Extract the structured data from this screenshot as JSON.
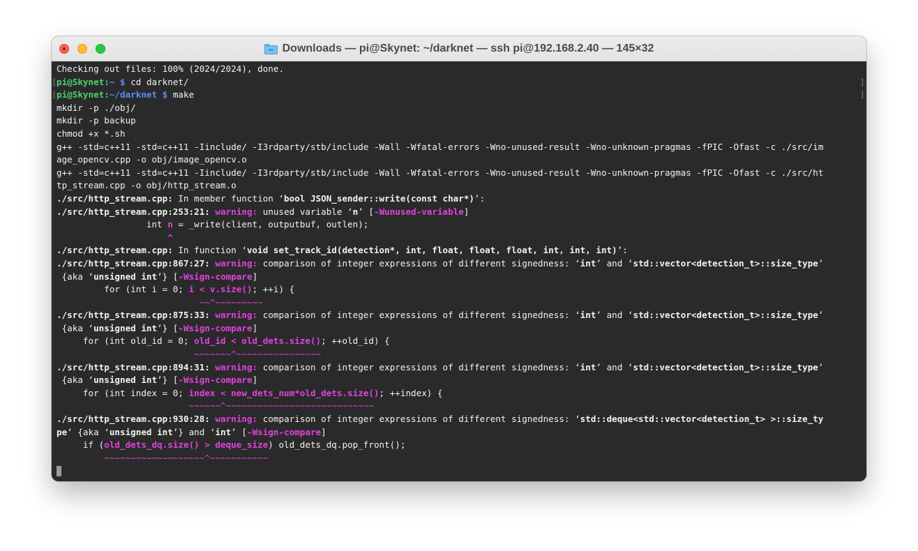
{
  "window": {
    "title": "Downloads — pi@Skynet: ~/darknet — ssh pi@192.168.2.40 — 145×32",
    "folder_icon": "folder-icon",
    "accent_magenta": "#e042e0",
    "prompt_user_color": "#4cd26b",
    "prompt_path_color": "#5b8cff"
  },
  "terminal": {
    "l1": "Checking out files: 100% (2024/2024), done.",
    "p1": {
      "bl": "[",
      "user": "pi@Skynet",
      "colon": ":",
      "path": "~",
      "dollar": " $",
      "cmd": " cd darknet/",
      "br": "]"
    },
    "p2": {
      "bl": "[",
      "user": "pi@Skynet",
      "colon": ":",
      "path": "~/darknet",
      "dollar": " $",
      "cmd": " make",
      "br": "]"
    },
    "l4": "mkdir -p ./obj/",
    "l5": "mkdir -p backup",
    "l6": "chmod +x *.sh",
    "l7": "g++ -std=c++11 -std=c++11 -Iinclude/ -I3rdparty/stb/include -Wall -Wfatal-errors -Wno-unused-result -Wno-unknown-pragmas -fPIC -Ofast -c ./src/im",
    "l8": "age_opencv.cpp -o obj/image_opencv.o",
    "l9": "g++ -std=c++11 -std=c++11 -Iinclude/ -I3rdparty/stb/include -Wall -Wfatal-errors -Wno-unused-result -Wno-unknown-pragmas -fPIC -Ofast -c ./src/ht",
    "l10": "tp_stream.cpp -o obj/http_stream.o",
    "l11": {
      "a": "./src/http_stream.cpp:",
      "b": " In member function ‘",
      "c": "bool JSON_sender::write(const char*)",
      "d": "’:"
    },
    "l12": {
      "a": "./src/http_stream.cpp:253:21:",
      "b": " ",
      "w": "warning:",
      "c": " unused variable ‘",
      "d": "n",
      "e": "’ [",
      "f": "-Wunused-variable",
      "g": "]"
    },
    "l13": {
      "a": "                 int ",
      "b": "n",
      "c": " = _write(client, outputbuf, outlen);"
    },
    "l14": "                     ^",
    "l15": {
      "a": "./src/http_stream.cpp:",
      "b": " In function ‘",
      "c": "void set_track_id(detection*, int, float, float, float, int, int, int)",
      "d": "’:"
    },
    "l16": {
      "a": "./src/http_stream.cpp:867:27:",
      "b": " ",
      "w": "warning:",
      "c": " comparison of integer expressions of different signedness: ‘",
      "d": "int",
      "e": "’ and ‘",
      "f": "std::vector<detection_t>::size_type",
      "g": "’"
    },
    "l17": {
      "a": " {aka ‘",
      "b": "unsigned int",
      "c": "’} [",
      "d": "-Wsign-compare",
      "e": "]"
    },
    "l18": {
      "a": "         for (int i = 0; ",
      "b": "i < v.size()",
      "c": "; ++i) {"
    },
    "l19": "                           ~~^~~~~~~~~~",
    "l20": {
      "a": "./src/http_stream.cpp:875:33:",
      "b": " ",
      "w": "warning:",
      "c": " comparison of integer expressions of different signedness: ‘",
      "d": "int",
      "e": "’ and ‘",
      "f": "std::vector<detection_t>::size_type",
      "g": "’"
    },
    "l21": {
      "a": " {aka ‘",
      "b": "unsigned int",
      "c": "’} [",
      "d": "-Wsign-compare",
      "e": "]"
    },
    "l22": {
      "a": "     for (int old_id = 0; ",
      "b": "old_id < old_dets.size()",
      "c": "; ++old_id) {"
    },
    "l23": "                          ~~~~~~~^~~~~~~~~~~~~~~~~",
    "l24": {
      "a": "./src/http_stream.cpp:894:31:",
      "b": " ",
      "w": "warning:",
      "c": " comparison of integer expressions of different signedness: ‘",
      "d": "int",
      "e": "’ and ‘",
      "f": "std::vector<detection_t>::size_type",
      "g": "’"
    },
    "l25": {
      "a": " {aka ‘",
      "b": "unsigned int",
      "c": "’} [",
      "d": "-Wsign-compare",
      "e": "]"
    },
    "l26": {
      "a": "     for (int index = 0; ",
      "b": "index < new_dets_num*old_dets.size()",
      "c": "; ++index) {"
    },
    "l27": "                         ~~~~~~^~~~~~~~~~~~~~~~~~~~~~~~~~~~~",
    "l28": {
      "a": "./src/http_stream.cpp:930:28:",
      "b": " ",
      "w": "warning:",
      "c": " comparison of integer expressions of different signedness: ‘",
      "d": "std::deque<std::vector<detection_t> >::size_ty",
      "e": ""
    },
    "l29": {
      "a": "pe",
      "b": "’ {aka ‘",
      "c": "unsigned int",
      "d": "’} and ‘",
      "e": "int",
      "f": "’ [",
      "g": "-Wsign-compare",
      "h": "]"
    },
    "l30": {
      "a": "     if (",
      "b": "old_dets_dq.size() > deque_size",
      "c": ") old_dets_dq.pop_front();"
    },
    "l31": "         ~~~~~~~~~~~~~~~~~~~^~~~~~~~~~~~"
  }
}
